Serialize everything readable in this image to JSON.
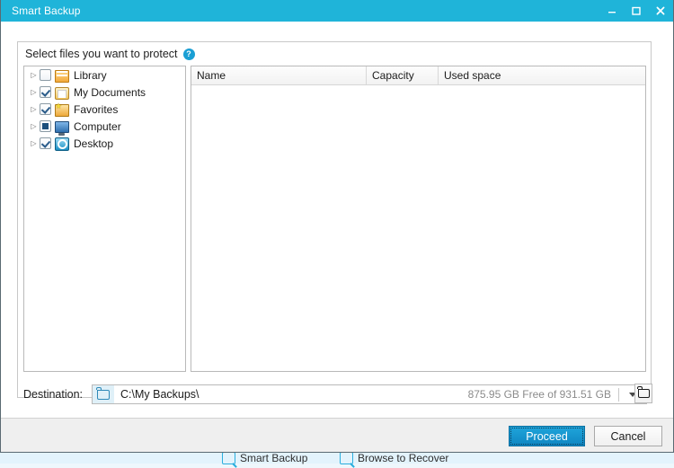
{
  "window": {
    "title": "Smart Backup",
    "controls": {
      "minimize": "minimize-button",
      "maximize": "maximize-button",
      "close": "close-button"
    }
  },
  "groupbox": {
    "title": "Select files you want to protect",
    "help_icon": "?"
  },
  "tree": {
    "items": [
      {
        "label": "Library",
        "checkbox": "unchecked",
        "icon": "library-folder-icon",
        "expander": "▷"
      },
      {
        "label": "My Documents",
        "checkbox": "checked",
        "icon": "documents-folder-icon",
        "expander": "▷"
      },
      {
        "label": "Favorites",
        "checkbox": "checked",
        "icon": "favorites-folder-icon",
        "expander": "▷"
      },
      {
        "label": "Computer",
        "checkbox": "partial",
        "icon": "computer-icon",
        "expander": "▷"
      },
      {
        "label": "Desktop",
        "checkbox": "checked",
        "icon": "desktop-icon",
        "expander": "▷"
      }
    ]
  },
  "list": {
    "columns": [
      "Name",
      "Capacity",
      "Used space"
    ],
    "rows": []
  },
  "destination": {
    "label": "Destination:",
    "path": "C:\\My Backups\\",
    "free_space": "875.95 GB Free of 931.51 GB",
    "dropdown_icon": "chevron-down-icon",
    "browse_icon": "folder-icon"
  },
  "footer": {
    "proceed_label": "Proceed",
    "cancel_label": "Cancel"
  },
  "background": {
    "tools": [
      {
        "label": "Smart Backup"
      },
      {
        "label": "Browse to Recover"
      }
    ]
  },
  "colors": {
    "titlebar": "#1fb4d9",
    "accent": "#1fa5db",
    "help": "#1a9fd4",
    "muted_text": "#8b8b8b",
    "panel_bg": "#efefef"
  }
}
